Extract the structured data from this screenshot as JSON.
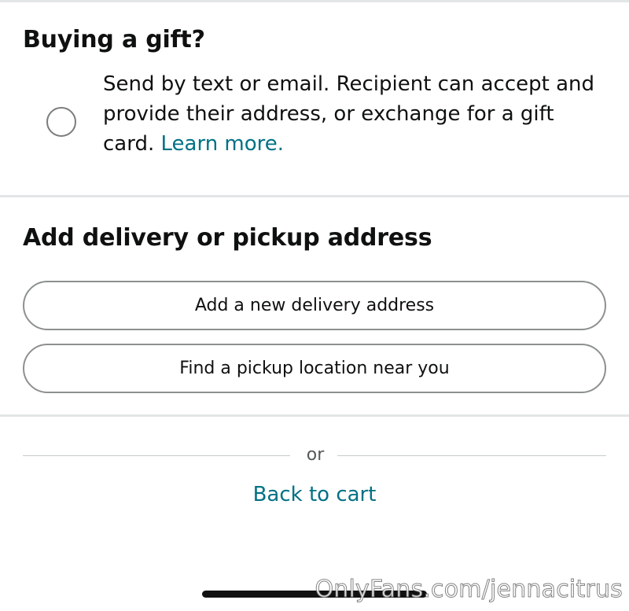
{
  "gift": {
    "title": "Buying a gift?",
    "description": "Send by text or email. Recipient can accept and provide their address, or exchange for a gift card.",
    "learn_more": "Learn more."
  },
  "address": {
    "title": "Add delivery or pickup address",
    "new_address_label": "Add a new delivery address",
    "pickup_label": "Find a pickup location near you"
  },
  "separator": {
    "or_label": "or"
  },
  "back_to_cart": "Back to cart",
  "watermark": "OnlyFans.com/jennacitrus",
  "colors": {
    "link": "#007185",
    "text": "#0f1111",
    "divider": "#e3e6e6"
  }
}
